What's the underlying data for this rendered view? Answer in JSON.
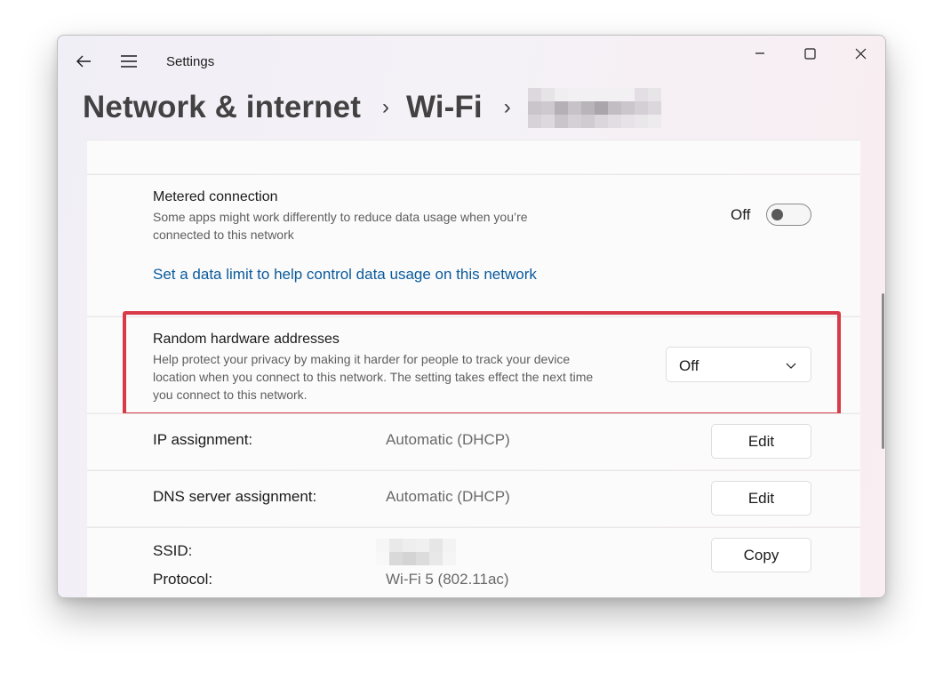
{
  "window": {
    "app_title": "Settings"
  },
  "breadcrumb": {
    "items": [
      "Network & internet",
      "Wi-Fi"
    ],
    "separator": "›"
  },
  "metered": {
    "title": "Metered connection",
    "description_line1": "Some apps might work differently to reduce data usage when you’re",
    "description_line2": "connected to this network",
    "toggle_state": "Off",
    "data_limit_link": "Set a data limit to help control data usage on this network"
  },
  "random_hw": {
    "title": "Random hardware addresses",
    "description_line1": "Help protect your privacy by making it harder for people to track your device",
    "description_line2": "location when you connect to this network. The setting takes effect the next time",
    "description_line3": "you connect to this network.",
    "selected": "Off"
  },
  "ip": {
    "label": "IP assignment:",
    "value": "Automatic (DHCP)",
    "button": "Edit"
  },
  "dns": {
    "label": "DNS server assignment:",
    "value": "Automatic (DHCP)",
    "button": "Edit"
  },
  "properties": {
    "ssid_label": "SSID:",
    "protocol_label": "Protocol:",
    "protocol_value": "Wi-Fi 5 (802.11ac)",
    "copy_button": "Copy"
  },
  "colors": {
    "link": "#0a5a9c",
    "highlight_border": "#d83b47"
  },
  "icons": {
    "back": "back-arrow-icon",
    "menu": "hamburger-menu-icon",
    "minimize": "minimize-icon",
    "maximize": "maximize-icon",
    "close": "close-icon",
    "dropdown": "chevron-down-icon"
  }
}
